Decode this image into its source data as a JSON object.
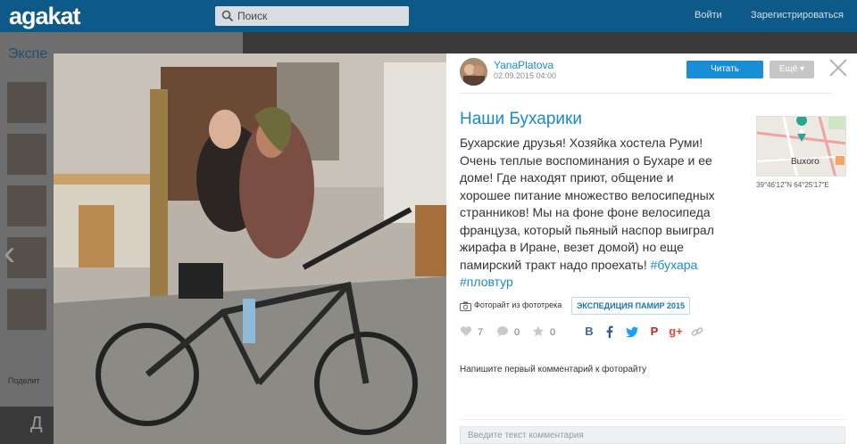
{
  "header": {
    "logo": "agakat",
    "search_placeholder": "Поиск",
    "login_label": "Войти",
    "register_label": "Зарегистрироваться"
  },
  "background": {
    "section_title": "Экспе",
    "note": "Поделит",
    "letters": "Д"
  },
  "post": {
    "author": "YanaPlatova",
    "date": "02.09.2015 04:00",
    "read_label": "Читать",
    "more_label": "Ещё",
    "title": "Наши Бухарики",
    "description": "Бухарские друзья! Хозяйка хостела Руми! Очень теплые воспоминания о Бухаре и ее доме! Где находят приют, общение и хорошее питание множество велосипедных странников! Мы на фоне фоне велосипеда француза, который пьяный наспор выиграл жирафа в Иране, везет домой) но еще памирский тракт надо проехать!",
    "hashtags": [
      "#бухара",
      "#пловтур"
    ],
    "map_city": "Buxoro",
    "coordinates": "39°46'12\"N 64°25'17\"E",
    "phototrek_label": "Фоторайт из фототрека",
    "expedition_badge": "ЭКСПЕДИЦИЯ ПАМИР 2015",
    "stats": {
      "likes": "7",
      "comments": "0",
      "favorites": "0"
    },
    "share": [
      "В",
      "f",
      "t",
      "P",
      "g+",
      "link"
    ],
    "first_comment_prompt": "Напишите первый комментарий к фоторайту",
    "comment_placeholder": "Введите текст комментария"
  },
  "colors": {
    "brand": "#0d5a88",
    "accent": "#1b8bc8",
    "button": "#178ed6"
  }
}
